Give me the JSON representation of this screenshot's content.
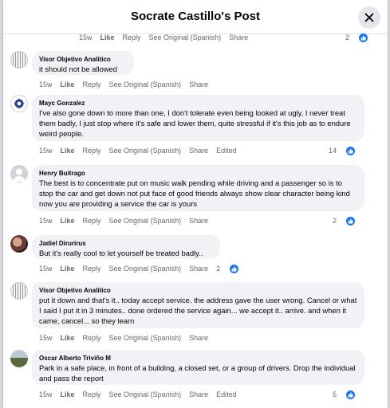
{
  "header": {
    "title": "Socrate Castillo's Post"
  },
  "top_meta": {
    "time": "15w",
    "like": "Like",
    "reply": "Reply",
    "see_original": "See Original (Spanish)",
    "share": "Share",
    "reactions": "2"
  },
  "comments": [
    {
      "author": "Visor Objetivo Analitico",
      "text": "it should not be allowed",
      "time": "15w",
      "like": "Like",
      "reply": "Reply",
      "see_original": "See Original (Spanish)",
      "share": "Share",
      "edited": "",
      "reactions": ""
    },
    {
      "author": "Mayc Gonzalez",
      "text": "I've also gone down to more than one, I don't tolerate even being looked at ugly, I never treat them badly, I just stop where it's safe and lower them, quite stressful if it's this job as to endure weird people.",
      "time": "15w",
      "like": "Like",
      "reply": "Reply",
      "see_original": "See Original (Spanish)",
      "share": "Share",
      "edited": "Edited",
      "reactions": "14"
    },
    {
      "author": "Henry Buitrago",
      "text": "The best is to concentrate put on music walk pending while driving and a passenger so is to stop the car and get down not put face of good friends always show clear character being kind now you are providing a service the car is yours",
      "time": "15w",
      "like": "Like",
      "reply": "Reply",
      "see_original": "See Original (Spanish)",
      "share": "Share",
      "edited": "",
      "reactions": "2"
    },
    {
      "author": "Jadiel Dirurirus",
      "text": "But it's really cool to let yourself be treated badly..",
      "time": "15w",
      "like": "Like",
      "reply": "Reply",
      "see_original": "See Original (Spanish)",
      "share": "Share",
      "edited": "",
      "reactions": "2"
    },
    {
      "author": "Visor Objetivo Analitico",
      "text": "put it down and that's it.. today accept service. the address gave the user wrong. Cancel or what I said I put it in 3 minutes.. done ordered the service again... we accept it.. arrive. and when it came, cancel... so they learn",
      "time": "15w",
      "like": "Like",
      "reply": "Reply",
      "see_original": "See Original (Spanish)",
      "share": "Share",
      "edited": "",
      "reactions": ""
    },
    {
      "author": "Oscar Alberto Triviño M",
      "text": "Park in a safe place, in front of a building, a closed set, or a group of drivers. Drop the individual and pass the report",
      "time": "15w",
      "like": "Like",
      "reply": "Reply",
      "see_original": "See Original (Spanish)",
      "share": "Share",
      "edited": "Edited",
      "reactions": "5"
    }
  ]
}
